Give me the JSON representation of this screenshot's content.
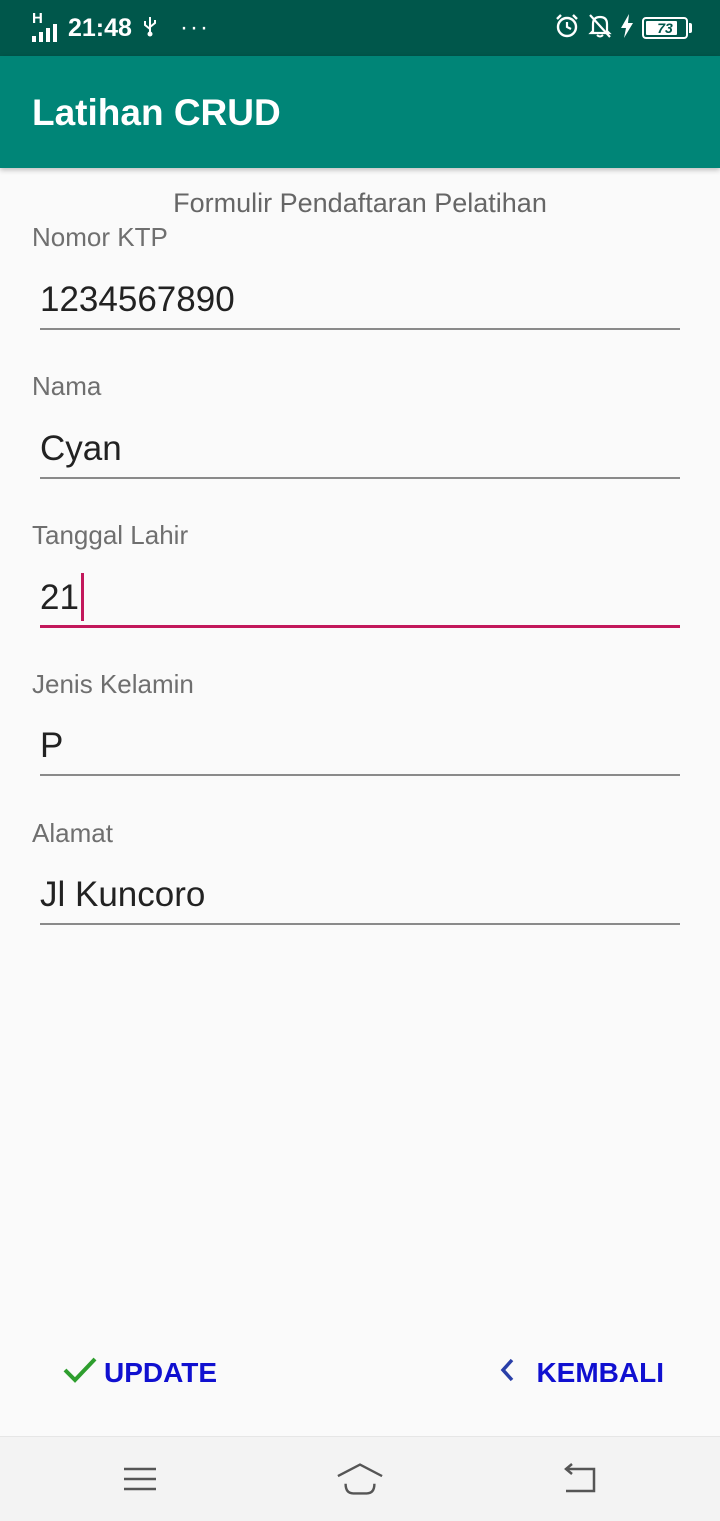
{
  "status_bar": {
    "network": "H",
    "time": "21:48",
    "more": "···",
    "battery_level": "73",
    "battery_fraction": 0.73
  },
  "app_bar": {
    "title": "Latihan CRUD"
  },
  "form": {
    "heading": "Formulir Pendaftaran Pelatihan",
    "fields": [
      {
        "label": "Nomor KTP",
        "value": "1234567890"
      },
      {
        "label": "Nama",
        "value": "Cyan"
      },
      {
        "label": "Tanggal Lahir",
        "value": "21"
      },
      {
        "label": "Jenis Kelamin",
        "value": "P"
      },
      {
        "label": "Alamat",
        "value": "Jl Kuncoro"
      }
    ]
  },
  "actions": {
    "update_label": "UPDATE",
    "back_label": "KEMBALI"
  },
  "colors": {
    "status_bar": "#00574b",
    "app_bar": "#008577",
    "accent": "#c2185b",
    "button_text": "#1010d0",
    "check": "#2e9e2e"
  },
  "nav_icons": [
    "menu-icon",
    "home-icon",
    "back-icon"
  ]
}
